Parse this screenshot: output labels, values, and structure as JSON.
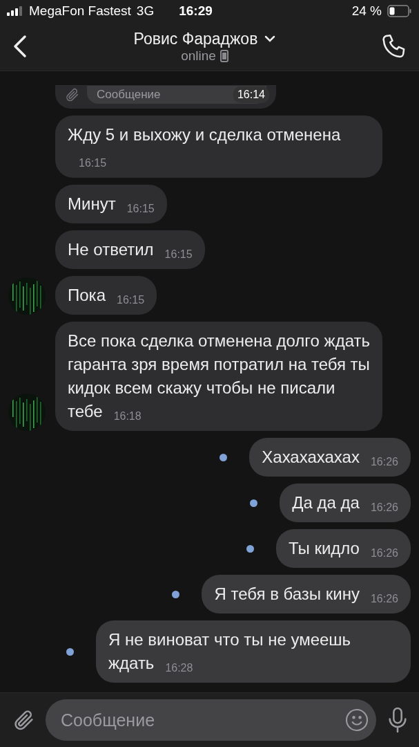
{
  "status_bar": {
    "carrier": "MegaFon Fastest",
    "network": "3G",
    "time": "16:29",
    "battery": "24 %"
  },
  "header": {
    "name": "Ровис Фараджов",
    "status": "online"
  },
  "messages": [
    {
      "kind": "screenshot",
      "placeholder": "Сообщение",
      "time": "16:14"
    },
    {
      "kind": "in",
      "text": "Жду 5 и выхожу и сделка отменена",
      "time": "16:15",
      "avatar": false
    },
    {
      "kind": "in",
      "text": "Минут",
      "time": "16:15",
      "avatar": false
    },
    {
      "kind": "in",
      "text": "Не ответил",
      "time": "16:15",
      "avatar": false
    },
    {
      "kind": "in",
      "text": "Пока",
      "time": "16:15",
      "avatar": true
    },
    {
      "kind": "in",
      "text": "Все пока сделка отменена долго ждать гаранта зря время потратил на тебя ты кидок всем скажу чтобы не писали тебе",
      "time": "16:18",
      "avatar": true
    },
    {
      "kind": "out",
      "text": "Хахахахахах",
      "time": "16:26",
      "unread": true
    },
    {
      "kind": "out",
      "text": "Да да да",
      "time": "16:26",
      "unread": true
    },
    {
      "kind": "out",
      "text": "Ты кидло",
      "time": "16:26",
      "unread": true
    },
    {
      "kind": "out",
      "text": "Я тебя в базы кину",
      "time": "16:26",
      "unread": true
    },
    {
      "kind": "out",
      "text": "Я не виноват что ты не умеешь ждать",
      "time": "16:28",
      "unread": true
    }
  ],
  "composer": {
    "placeholder": "Сообщение"
  }
}
